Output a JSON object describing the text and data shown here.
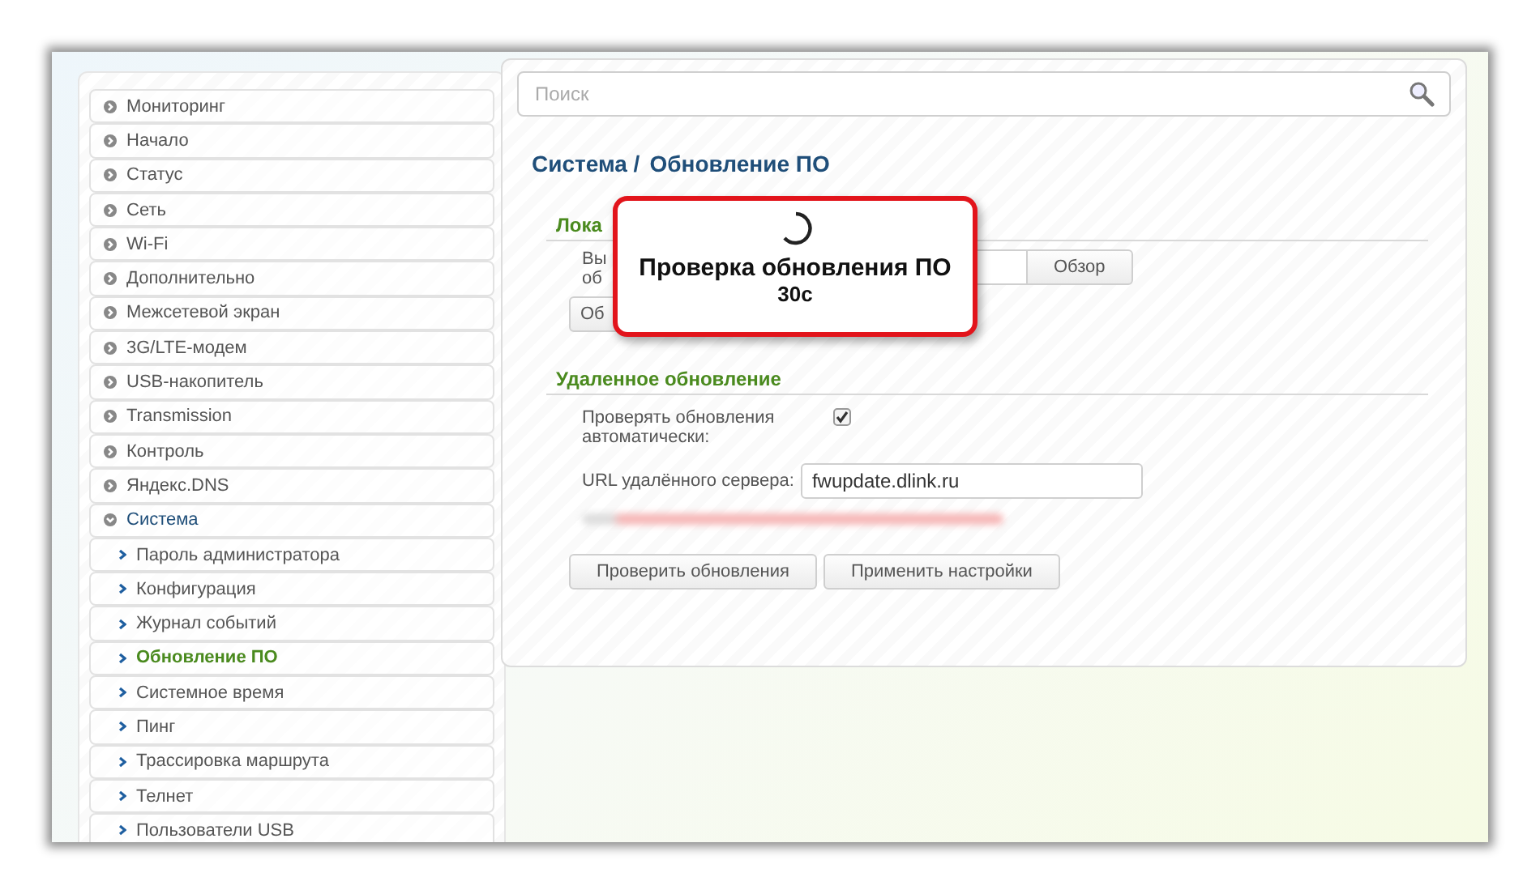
{
  "sidebar": {
    "items": [
      {
        "label": "Мониторинг",
        "expanded": false
      },
      {
        "label": "Начало",
        "expanded": false
      },
      {
        "label": "Статус",
        "expanded": false
      },
      {
        "label": "Сеть",
        "expanded": false
      },
      {
        "label": "Wi-Fi",
        "expanded": false
      },
      {
        "label": "Дополнительно",
        "expanded": false
      },
      {
        "label": "Межсетевой экран",
        "expanded": false
      },
      {
        "label": "3G/LTE-модем",
        "expanded": false
      },
      {
        "label": "USB-накопитель",
        "expanded": false
      },
      {
        "label": "Transmission",
        "expanded": false
      },
      {
        "label": "Контроль",
        "expanded": false
      },
      {
        "label": "Яндекс.DNS",
        "expanded": false
      },
      {
        "label": "Система",
        "expanded": true,
        "children": [
          {
            "label": "Пароль администратора",
            "selected": false
          },
          {
            "label": "Конфигурация",
            "selected": false
          },
          {
            "label": "Журнал событий",
            "selected": false
          },
          {
            "label": "Обновление ПО",
            "selected": true
          },
          {
            "label": "Системное время",
            "selected": false
          },
          {
            "label": "Пинг",
            "selected": false
          },
          {
            "label": "Трассировка маршрута",
            "selected": false
          },
          {
            "label": "Телнет",
            "selected": false
          },
          {
            "label": "Пользователи USB",
            "selected": false
          }
        ]
      }
    ]
  },
  "search": {
    "placeholder": "Поиск"
  },
  "breadcrumb": [
    "Система /",
    "Обновление ПО"
  ],
  "local_update": {
    "title": "Лока",
    "label": [
      "Вы",
      "об"
    ],
    "browse_button": "Обзор",
    "update_button": "Об"
  },
  "remote_update": {
    "title": "Удаленное обновление",
    "auto_check": {
      "label": "Проверять обновления автоматически:",
      "checked": true
    },
    "server_url": {
      "label": "URL удалённого сервера:",
      "value": "fwupdate.dlink.ru"
    },
    "buttons": [
      "Проверить обновления",
      "Применить настройки"
    ]
  },
  "progress_dialog": {
    "title": "Проверка обновления ПО",
    "countdown": "30с"
  }
}
